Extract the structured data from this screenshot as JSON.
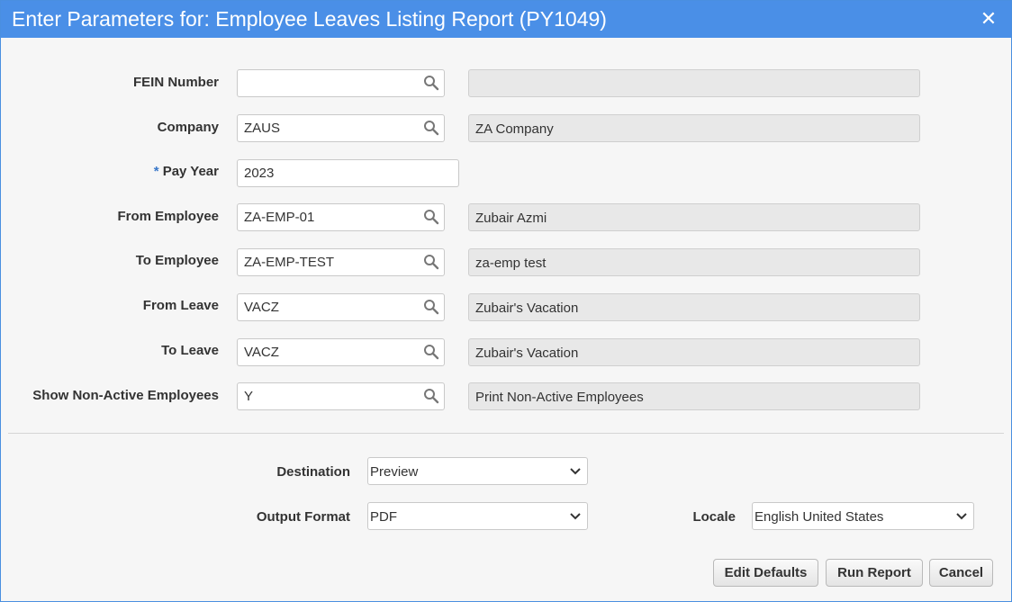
{
  "dialog": {
    "title": "Enter Parameters for: Employee Leaves Listing Report (PY1049)",
    "close_glyph": "✕"
  },
  "fields": [
    {
      "label": "FEIN Number",
      "required": false,
      "value": "",
      "description": "",
      "lookup": true
    },
    {
      "label": "Company",
      "required": false,
      "value": "ZAUS",
      "description": "ZA Company",
      "lookup": true
    },
    {
      "label": "Pay Year",
      "required": true,
      "value": "2023",
      "lookup": false
    },
    {
      "label": "From Employee",
      "required": false,
      "value": "ZA-EMP-01",
      "description": "Zubair Azmi",
      "lookup": true
    },
    {
      "label": "To Employee",
      "required": false,
      "value": "ZA-EMP-TEST",
      "description": "za-emp test",
      "lookup": true
    },
    {
      "label": "From Leave",
      "required": false,
      "value": "VACZ",
      "description": "Zubair's Vacation",
      "lookup": true
    },
    {
      "label": "To Leave",
      "required": false,
      "value": "VACZ",
      "description": "Zubair's Vacation",
      "lookup": true
    },
    {
      "label": "Show Non-Active Employees",
      "required": false,
      "value": "Y",
      "description": "Print Non-Active Employees",
      "lookup": true
    }
  ],
  "required_marker": "*",
  "output": {
    "destination_label": "Destination",
    "destination_value": "Preview",
    "format_label": "Output Format",
    "format_value": "PDF",
    "locale_label": "Locale",
    "locale_value": "English United States"
  },
  "buttons": {
    "edit_defaults": "Edit Defaults",
    "run_report": "Run Report",
    "cancel": "Cancel"
  },
  "colors": {
    "titlebar": "#4a8fe7",
    "required_marker": "#3a78c9"
  }
}
